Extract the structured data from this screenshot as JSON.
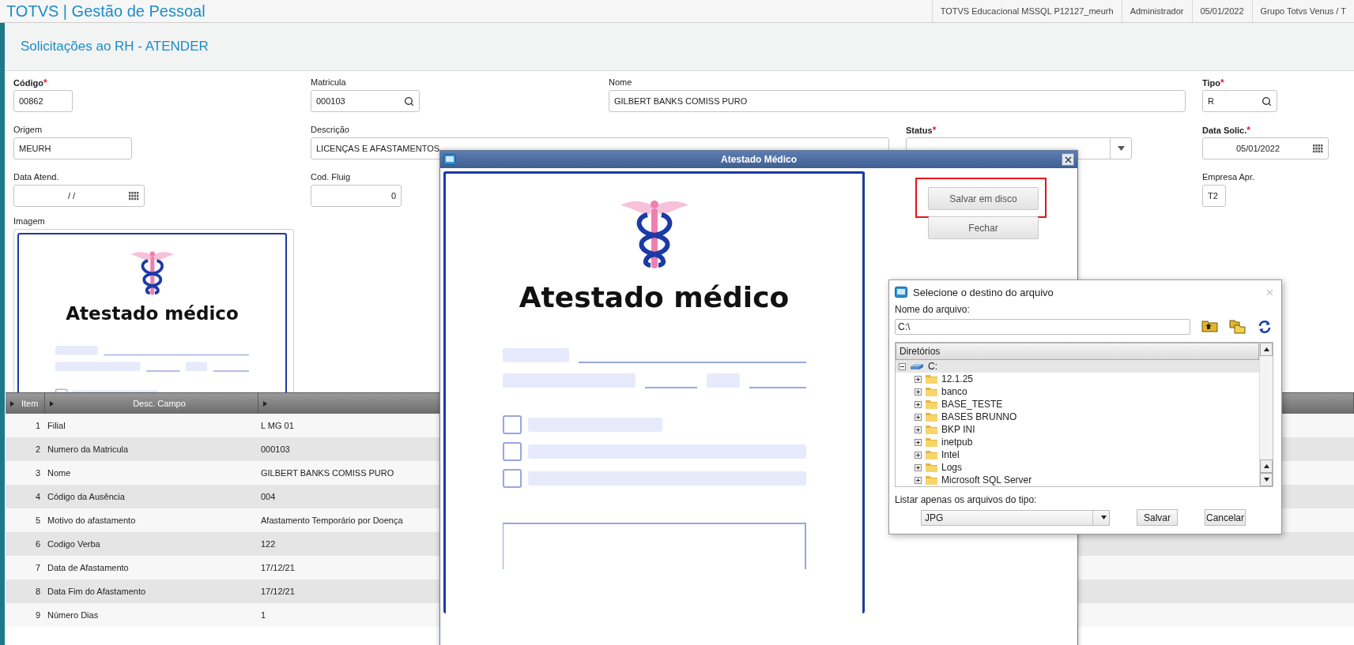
{
  "header": {
    "app_title": "TOTVS | Gestão de Pessoal",
    "info": [
      "TOTVS Educacional MSSQL P12127_meurh",
      "Administrador",
      "05/01/2022",
      "Grupo Totvs Venus / T"
    ]
  },
  "page_title": "Solicitações ao RH - ATENDER",
  "form": [
    [
      {
        "label": "Código",
        "mark": "*",
        "value": "00862",
        "kind": "text"
      },
      {
        "label": "Matricula",
        "value": "000103",
        "kind": "lookup"
      },
      {
        "label": "Nome",
        "value": "GILBERT BANKS COMISS PURO",
        "kind": "text"
      },
      {
        "label": "Tipo",
        "mark": "*",
        "value": "R",
        "kind": "lookup"
      }
    ],
    [
      {
        "label": "Origem",
        "value": "MEURH",
        "kind": "text"
      },
      {
        "label": "Descrição",
        "value": "LICENÇAS E AFASTAMENTOS",
        "kind": "text"
      },
      {
        "label": "Status",
        "mark": "*",
        "kind": "select"
      },
      {
        "label": "Data Solic.",
        "mark": "*",
        "value": "05/01/2022",
        "kind": "date"
      }
    ],
    [
      {
        "label": "Data Atend.",
        "value": "/ /",
        "kind": "date"
      },
      {
        "label": "Cod. Fluig",
        "value": "0",
        "kind": "number"
      },
      {
        "label": "Empresa Apr.",
        "value": "T2",
        "kind": "text"
      }
    ]
  ],
  "image_label": "Imagem",
  "image_document": {
    "title": "Atestado médico"
  },
  "table": {
    "columns": [
      "Item",
      "Desc. Campo"
    ],
    "rows": [
      {
        "item": "1",
        "field": "Filial",
        "value": "L MG 01"
      },
      {
        "item": "2",
        "field": "Numero da Matricula",
        "value": "000103"
      },
      {
        "item": "3",
        "field": "Nome",
        "value": "GILBERT BANKS COMISS PURO"
      },
      {
        "item": "4",
        "field": "Código da Ausência",
        "value": "004"
      },
      {
        "item": "5",
        "field": "Motivo do afastamento",
        "value": "Afastamento Temporário por Doença"
      },
      {
        "item": "6",
        "field": "Codigo Verba",
        "value": "122"
      },
      {
        "item": "7",
        "field": "Data de Afastamento",
        "value": "17/12/21"
      },
      {
        "item": "8",
        "field": "Data Fim do Afastamento",
        "value": "17/12/21"
      },
      {
        "item": "9",
        "field": "Número Dias",
        "value": "1"
      }
    ]
  },
  "viewer_dialog": {
    "title": "Atestado Médico",
    "document": {
      "title": "Atestado médico"
    },
    "buttons": [
      {
        "label": "Salvar em disco",
        "highlighted": true
      },
      {
        "label": "Fechar",
        "highlighted": false
      }
    ]
  },
  "file_dialog": {
    "title": "Selecione o destino do arquivo",
    "filename_label": "Nome do arquivo:",
    "filename": "C:\\",
    "tree_header": "Diretórios",
    "tree": [
      {
        "label": "C:",
        "expanded": true,
        "selected": true,
        "children": [
          {
            "label": "12.1.25",
            "expanded": false,
            "selected": false
          },
          {
            "label": "banco",
            "expanded": false,
            "selected": false
          },
          {
            "label": "BASE_TESTE",
            "expanded": false,
            "selected": false
          },
          {
            "label": "BASES BRUNNO",
            "expanded": false,
            "selected": false
          },
          {
            "label": "BKP INI",
            "expanded": false,
            "selected": false
          },
          {
            "label": "inetpub",
            "expanded": false,
            "selected": false
          },
          {
            "label": "Intel",
            "expanded": false,
            "selected": false
          },
          {
            "label": "Logs",
            "expanded": false,
            "selected": false
          },
          {
            "label": "Microsoft SQL Server",
            "expanded": false,
            "selected": false
          }
        ]
      }
    ],
    "filter_label": "Listar apenas os arquivos do tipo:",
    "filter_value": "JPG",
    "buttons": [
      "Salvar",
      "Cancelar"
    ]
  }
}
